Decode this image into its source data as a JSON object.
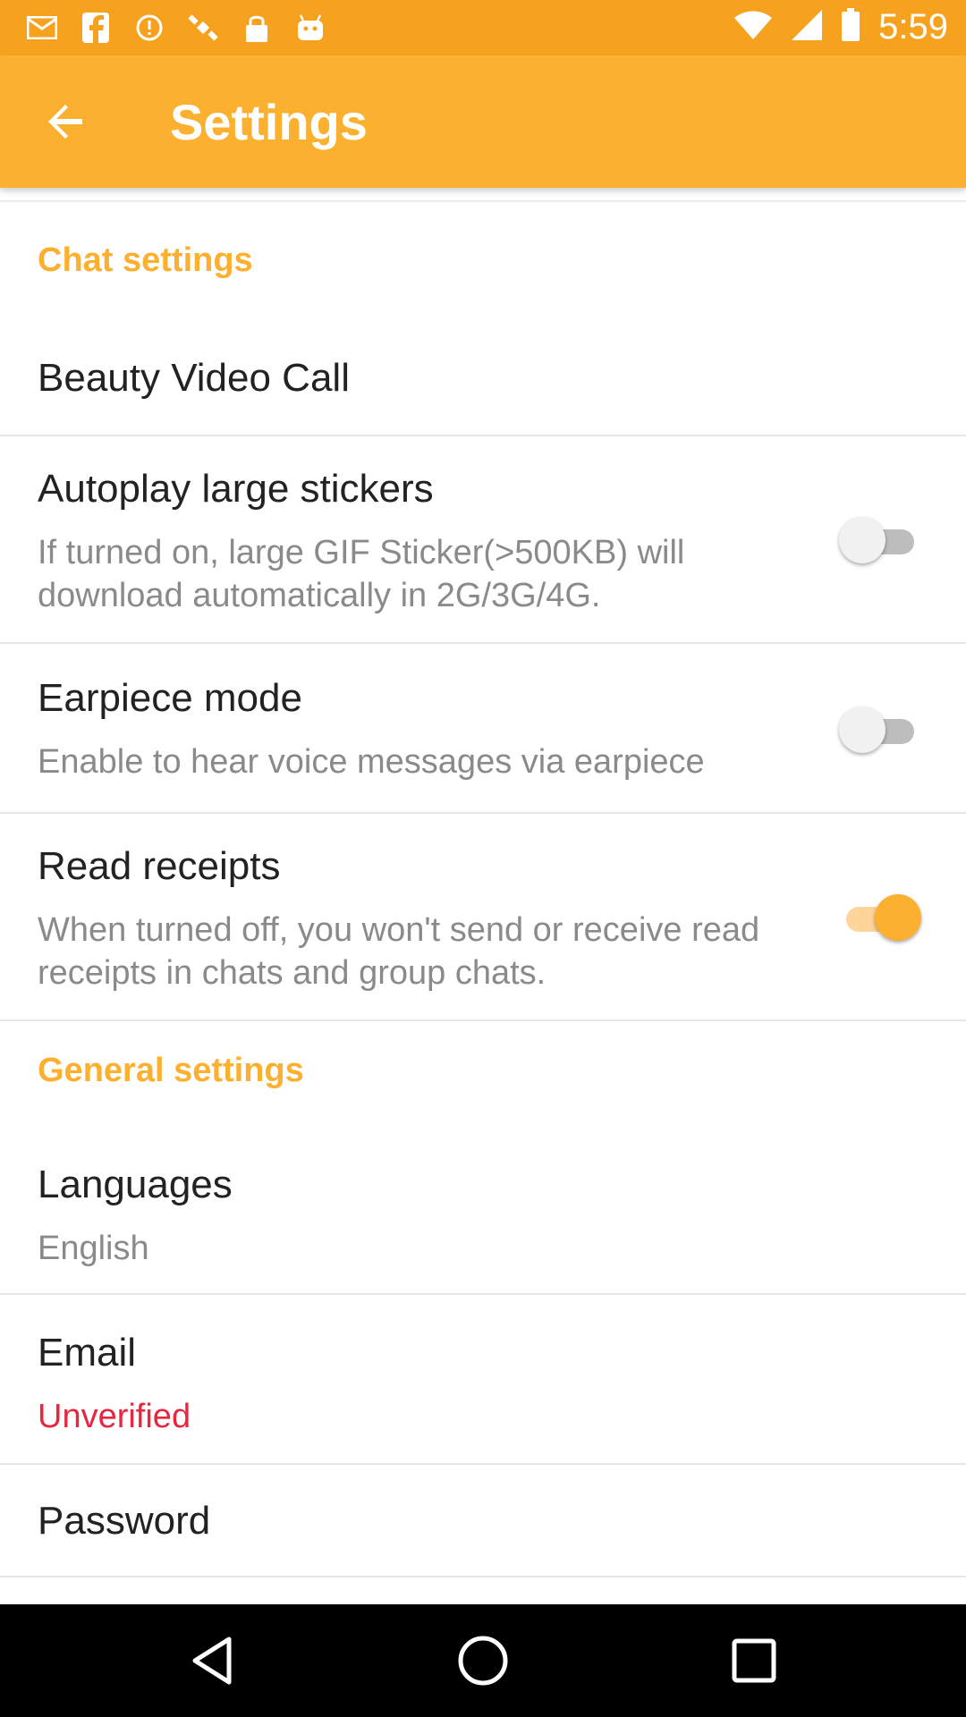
{
  "status_bar": {
    "time": "5:59",
    "left_icons": [
      "mail-icon",
      "facebook-icon",
      "alert-circle-icon",
      "satellite-icon",
      "lock-icon",
      "android-icon"
    ],
    "right_icons": [
      "wifi-icon",
      "signal-icon",
      "battery-icon"
    ]
  },
  "app_bar": {
    "back_icon": "arrow-left-icon",
    "title": "Settings"
  },
  "sections": {
    "chat": {
      "header": "Chat settings",
      "beauty_video_call": {
        "title": "Beauty Video Call"
      },
      "autoplay": {
        "title": "Autoplay large stickers",
        "subtitle": "If turned on, large GIF Sticker(>500KB) will download automatically in 2G/3G/4G.",
        "enabled": false
      },
      "earpiece": {
        "title": "Earpiece mode",
        "subtitle": "Enable to hear voice messages via earpiece",
        "enabled": false
      },
      "read_receipts": {
        "title": "Read receipts",
        "subtitle": "When turned off, you won't send or receive read receipts in chats and group chats.",
        "enabled": true
      }
    },
    "general": {
      "header": "General settings",
      "languages": {
        "title": "Languages",
        "value": "English"
      },
      "email": {
        "title": "Email",
        "value": "Unverified"
      },
      "password": {
        "title": "Password"
      }
    }
  },
  "nav_bar": {
    "icons": [
      "back-triangle-icon",
      "home-circle-icon",
      "recents-square-icon"
    ]
  },
  "colors": {
    "accent": "#fbb02f",
    "status_bar": "#f6a21e",
    "warning_text": "#e8263f"
  }
}
